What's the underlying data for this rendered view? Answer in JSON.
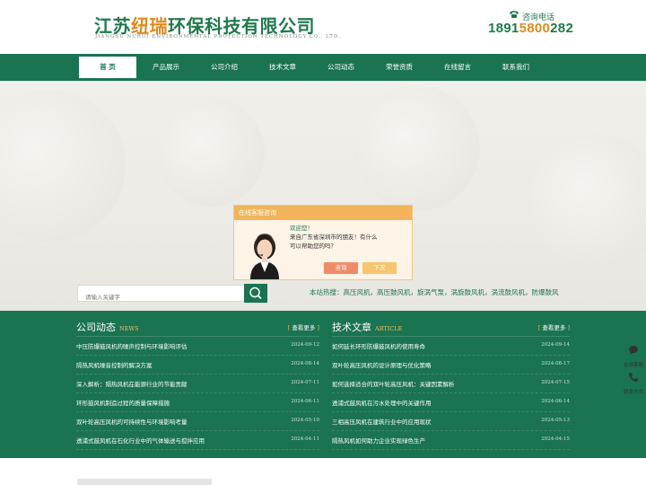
{
  "header": {
    "logo_part1": "江苏",
    "logo_part2": "纽瑞",
    "logo_part3": "环保科技有限公司",
    "logo_en": "JIANGSU NURUI ENVIRONMENTAL PROTECTION TECHNOLOGY CO., LTD.",
    "hotline_label": "咨询电话",
    "phone_part1": "1891",
    "phone_part2": "5800",
    "phone_part3": "282"
  },
  "nav": {
    "items": [
      {
        "label": "首 页"
      },
      {
        "label": "产品展示"
      },
      {
        "label": "公司介绍"
      },
      {
        "label": "技术文章"
      },
      {
        "label": "公司动态"
      },
      {
        "label": "荣誉资质"
      },
      {
        "label": "在线留言"
      },
      {
        "label": "联系我们"
      }
    ]
  },
  "popup": {
    "title": "在线客服咨询",
    "line1": "欢迎您！",
    "line2": "来自广东省深圳市的朋友！有什么",
    "line3": "可以帮助您的吗？",
    "consult_label": "咨询",
    "later_label": "下次"
  },
  "search": {
    "placeholder": "请输入关键字",
    "hotwords": "本站热搜：高压风机，高压鼓风机，旋涡气泵，涡旋鼓风机，涡流鼓风机，防爆鼓风"
  },
  "news": {
    "title": "公司动态",
    "title_en": "NEWS",
    "more": "查看更多",
    "items": [
      {
        "title": "中压防爆鼓风机的噪声控制与环境影响评估",
        "date": "2024-09-12"
      },
      {
        "title": "隔热风机噪音控制的解决方案",
        "date": "2024-08-14"
      },
      {
        "title": "深入解析：隔热风机在能源行业的节能贡献",
        "date": "2024-07-11"
      },
      {
        "title": "环形鼓风机制造过程的质量保障措施",
        "date": "2024-06-11"
      },
      {
        "title": "双叶轮高压风机的可持续性与环境影响考量",
        "date": "2024-05-10"
      },
      {
        "title": "透浦式鼓风机在石化行业中的气体输送与搅拌应用",
        "date": "2024-04-11"
      }
    ]
  },
  "articles": {
    "title": "技术文章",
    "title_en": "ARTICLE",
    "more": "查看更多",
    "items": [
      {
        "title": "如何延长环形防爆鼓风机的使用寿命",
        "date": "2024-09-14"
      },
      {
        "title": "双叶轮高压风机的设计原理与优化策略",
        "date": "2024-08-17"
      },
      {
        "title": "如何选择适合的双叶轮高压风机：关键因素解析",
        "date": "2024-07-15"
      },
      {
        "title": "透浦式鼓风机在污水处理中的关键作用",
        "date": "2024-06-14"
      },
      {
        "title": "三相高压风机在建筑行业中的应用现状",
        "date": "2024-05-13"
      },
      {
        "title": "隔热风机如何助力企业实现绿色生产",
        "date": "2024-04-15"
      }
    ]
  },
  "side": {
    "service_label": "在线客服",
    "contact_label": "联系方式"
  },
  "colors": {
    "brand_green": "#1a7351",
    "accent_orange": "#e08a1e"
  }
}
